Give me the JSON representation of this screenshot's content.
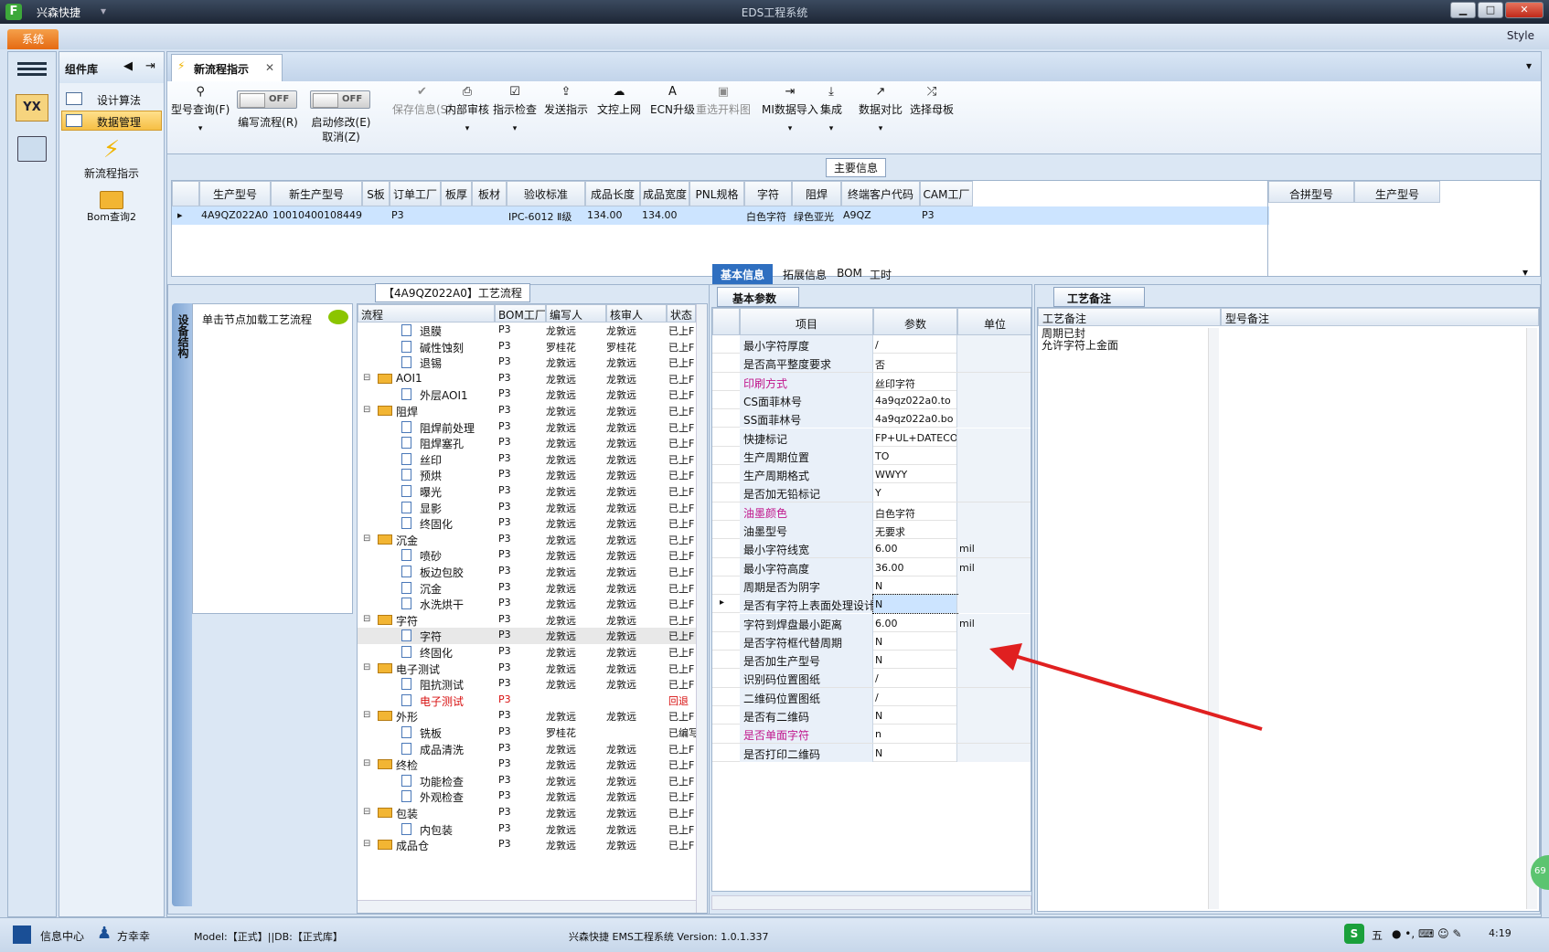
{
  "titlebar": {
    "quick_access": "兴森快捷",
    "title": "EDS工程系统",
    "min": "▁",
    "max": "□",
    "close": "✕"
  },
  "menubar": {
    "system": "系统",
    "style": "Style"
  },
  "nav": {
    "title": "组件库",
    "items": [
      "设计算法",
      "数据管理"
    ],
    "tiles": [
      "新流程指示",
      "Bom查询2"
    ]
  },
  "doc_tab": "新流程指示",
  "ribbon": [
    {
      "label": "型号查询(F)",
      "icon": "⚲",
      "arrow": true
    },
    {
      "label": "编写流程(R)",
      "toggle": "OFF"
    },
    {
      "label": "启动修改(E)",
      "label2": "取消(Z)",
      "toggle": "OFF"
    },
    {
      "label": "保存信息(S)",
      "icon": "✔",
      "disabled": true
    },
    {
      "label": "内部审核",
      "icon": "⎙",
      "arrow": true
    },
    {
      "label": "指示检查",
      "icon": "☑",
      "arrow": true
    },
    {
      "label": "发送指示",
      "icon": "⇪"
    },
    {
      "label": "文控上网",
      "icon": "☁"
    },
    {
      "label": "ECN升级",
      "icon": "A"
    },
    {
      "label": "重选开料图",
      "icon": "▣",
      "disabled": true
    },
    {
      "label": "MI数据导入",
      "icon": "⇥",
      "arrow": true
    },
    {
      "label": "集成",
      "icon": "⤓",
      "arrow": true
    },
    {
      "label": "数据对比",
      "icon": "↗",
      "arrow": true
    },
    {
      "label": "选择母板",
      "icon": "⤮"
    }
  ],
  "main_info": {
    "label": "主要信息",
    "headers": [
      "生产型号",
      "新生产型号",
      "S板",
      "订单工厂",
      "板厚",
      "板材",
      "验收标准",
      "成品长度",
      "成品宽度",
      "PNL规格",
      "字符",
      "阻焊",
      "终端客户代码",
      "CAM工厂"
    ],
    "row": [
      "4A9QZ022A0",
      "10010400108449",
      "",
      "P3",
      "",
      "",
      "IPC-6012 Ⅱ级",
      "134.00",
      "134.00",
      "",
      "白色字符",
      "绿色亚光",
      "A9QZ",
      "P3"
    ],
    "side_headers": [
      "合拼型号",
      "生产型号"
    ]
  },
  "flow": {
    "title": "【4A9QZ022A0】工艺流程",
    "side_tab": "设备结构",
    "load_hint": "单击节点加载工艺流程",
    "headers": [
      "流程",
      "BOM工厂",
      "编写人",
      "核审人",
      "状态"
    ],
    "rows": [
      {
        "n": "退膜",
        "l": 2,
        "f": "P3",
        "w": "龙敦远",
        "r": "龙敦远",
        "s": "已上F"
      },
      {
        "n": "碱性蚀刻",
        "l": 2,
        "f": "P3",
        "w": "罗桂花",
        "r": "罗桂花",
        "s": "已上F"
      },
      {
        "n": "退锡",
        "l": 2,
        "f": "P3",
        "w": "龙敦远",
        "r": "龙敦远",
        "s": "已上F"
      },
      {
        "n": "AOI1",
        "l": 1,
        "f": "P3",
        "w": "龙敦远",
        "r": "龙敦远",
        "s": "已上F"
      },
      {
        "n": "外层AOI1",
        "l": 2,
        "f": "P3",
        "w": "龙敦远",
        "r": "龙敦远",
        "s": "已上F"
      },
      {
        "n": "阻焊",
        "l": 1,
        "f": "P3",
        "w": "龙敦远",
        "r": "龙敦远",
        "s": "已上F"
      },
      {
        "n": "阻焊前处理",
        "l": 2,
        "f": "P3",
        "w": "龙敦远",
        "r": "龙敦远",
        "s": "已上F"
      },
      {
        "n": "阻焊塞孔",
        "l": 2,
        "f": "P3",
        "w": "龙敦远",
        "r": "龙敦远",
        "s": "已上F"
      },
      {
        "n": "丝印",
        "l": 2,
        "f": "P3",
        "w": "龙敦远",
        "r": "龙敦远",
        "s": "已上F"
      },
      {
        "n": "预烘",
        "l": 2,
        "f": "P3",
        "w": "龙敦远",
        "r": "龙敦远",
        "s": "已上F"
      },
      {
        "n": "曝光",
        "l": 2,
        "f": "P3",
        "w": "龙敦远",
        "r": "龙敦远",
        "s": "已上F"
      },
      {
        "n": "显影",
        "l": 2,
        "f": "P3",
        "w": "龙敦远",
        "r": "龙敦远",
        "s": "已上F"
      },
      {
        "n": "终固化",
        "l": 2,
        "f": "P3",
        "w": "龙敦远",
        "r": "龙敦远",
        "s": "已上F"
      },
      {
        "n": "沉金",
        "l": 1,
        "f": "P3",
        "w": "龙敦远",
        "r": "龙敦远",
        "s": "已上F"
      },
      {
        "n": "喷砂",
        "l": 2,
        "f": "P3",
        "w": "龙敦远",
        "r": "龙敦远",
        "s": "已上F"
      },
      {
        "n": "板边包胶",
        "l": 2,
        "f": "P3",
        "w": "龙敦远",
        "r": "龙敦远",
        "s": "已上F"
      },
      {
        "n": "沉金",
        "l": 2,
        "f": "P3",
        "w": "龙敦远",
        "r": "龙敦远",
        "s": "已上F"
      },
      {
        "n": "水洗烘干",
        "l": 2,
        "f": "P3",
        "w": "龙敦远",
        "r": "龙敦远",
        "s": "已上F"
      },
      {
        "n": "字符",
        "l": 1,
        "f": "P3",
        "w": "龙敦远",
        "r": "龙敦远",
        "s": "已上F"
      },
      {
        "n": "字符",
        "l": 2,
        "f": "P3",
        "w": "龙敦远",
        "r": "龙敦远",
        "s": "已上F",
        "sel": true
      },
      {
        "n": "终固化",
        "l": 2,
        "f": "P3",
        "w": "龙敦远",
        "r": "龙敦远",
        "s": "已上F"
      },
      {
        "n": "电子测试",
        "l": 1,
        "f": "P3",
        "w": "龙敦远",
        "r": "龙敦远",
        "s": "已上F"
      },
      {
        "n": "阻抗测试",
        "l": 2,
        "f": "P3",
        "w": "龙敦远",
        "r": "龙敦远",
        "s": "已上F"
      },
      {
        "n": "电子测试",
        "l": 2,
        "f": "P3",
        "w": "",
        "r": "",
        "s": "回退",
        "red": true
      },
      {
        "n": "外形",
        "l": 1,
        "f": "P3",
        "w": "龙敦远",
        "r": "龙敦远",
        "s": "已上F"
      },
      {
        "n": "铣板",
        "l": 2,
        "f": "P3",
        "w": "罗桂花",
        "r": "",
        "s": "已编写"
      },
      {
        "n": "成品清洗",
        "l": 2,
        "f": "P3",
        "w": "龙敦远",
        "r": "龙敦远",
        "s": "已上F"
      },
      {
        "n": "终检",
        "l": 1,
        "f": "P3",
        "w": "龙敦远",
        "r": "龙敦远",
        "s": "已上F"
      },
      {
        "n": "功能检查",
        "l": 2,
        "f": "P3",
        "w": "龙敦远",
        "r": "龙敦远",
        "s": "已上F"
      },
      {
        "n": "外观检查",
        "l": 2,
        "f": "P3",
        "w": "龙敦远",
        "r": "龙敦远",
        "s": "已上F"
      },
      {
        "n": "包装",
        "l": 1,
        "f": "P3",
        "w": "龙敦远",
        "r": "龙敦远",
        "s": "已上F"
      },
      {
        "n": "内包装",
        "l": 2,
        "f": "P3",
        "w": "龙敦远",
        "r": "龙敦远",
        "s": "已上F"
      },
      {
        "n": "成品仓",
        "l": 1,
        "f": "P3",
        "w": "龙敦远",
        "r": "龙敦远",
        "s": "已上F"
      }
    ]
  },
  "info_tabs": [
    "基本信息",
    "拓展信息",
    "BOM",
    "工时"
  ],
  "params": {
    "tab": "基本参数",
    "headers": [
      "项目",
      "参数",
      "单位"
    ],
    "rows": [
      {
        "k": "最小字符厚度",
        "v": "/",
        "u": ""
      },
      {
        "k": "是否高平整度要求",
        "v": "否",
        "u": ""
      },
      {
        "k": "印刷方式",
        "v": "丝印字符",
        "u": "",
        "pink": true
      },
      {
        "k": "CS面菲林号",
        "v": "4a9qz022a0.to",
        "u": ""
      },
      {
        "k": "SS面菲林号",
        "v": "4a9qz022a0.bo",
        "u": ""
      },
      {
        "k": "快捷标记",
        "v": "FP+UL+DATECODE",
        "u": ""
      },
      {
        "k": "生产周期位置",
        "v": "TO",
        "u": ""
      },
      {
        "k": "生产周期格式",
        "v": "WWYY",
        "u": ""
      },
      {
        "k": "是否加无铅标记",
        "v": "Y",
        "u": ""
      },
      {
        "k": "油墨颜色",
        "v": "白色字符",
        "u": "",
        "pink": true
      },
      {
        "k": "油墨型号",
        "v": "无要求",
        "u": ""
      },
      {
        "k": "最小字符线宽",
        "v": "6.00",
        "u": "mil"
      },
      {
        "k": "最小字符高度",
        "v": "36.00",
        "u": "mil"
      },
      {
        "k": "周期是否为阴字",
        "v": "N",
        "u": ""
      },
      {
        "k": "是否有字符上表面处理设计",
        "v": "N",
        "u": "",
        "sel": true
      },
      {
        "k": "字符到焊盘最小距离",
        "v": "6.00",
        "u": "mil"
      },
      {
        "k": "是否字符框代替周期",
        "v": "N",
        "u": ""
      },
      {
        "k": "是否加生产型号",
        "v": "N",
        "u": ""
      },
      {
        "k": "识别码位置图纸",
        "v": "/",
        "u": ""
      },
      {
        "k": "二维码位置图纸",
        "v": "/",
        "u": ""
      },
      {
        "k": "是否有二维码",
        "v": "N",
        "u": ""
      },
      {
        "k": "是否单面字符",
        "v": "n",
        "u": "",
        "pink": true
      },
      {
        "k": "是否打印二维码",
        "v": "N",
        "u": ""
      }
    ]
  },
  "remarks": {
    "tab": "工艺备注",
    "headers": [
      "工艺备注",
      "型号备注"
    ],
    "line1": "周期已封",
    "line2": "允许字符上金面"
  },
  "status": {
    "info_center": "信息中心",
    "user": "方幸幸",
    "model": "Model:【正式】||DB:【正式库】",
    "app": "兴森快捷 EMS工程系统 Version: 1.0.1.337",
    "ime": "五",
    "clock": "4:19",
    "badge": "69"
  },
  "colors": {
    "accent_orange": "#e56a12",
    "selection_blue": "#cce4ff",
    "pink_label": "#c0168c",
    "arrow_red": "#e02020"
  }
}
